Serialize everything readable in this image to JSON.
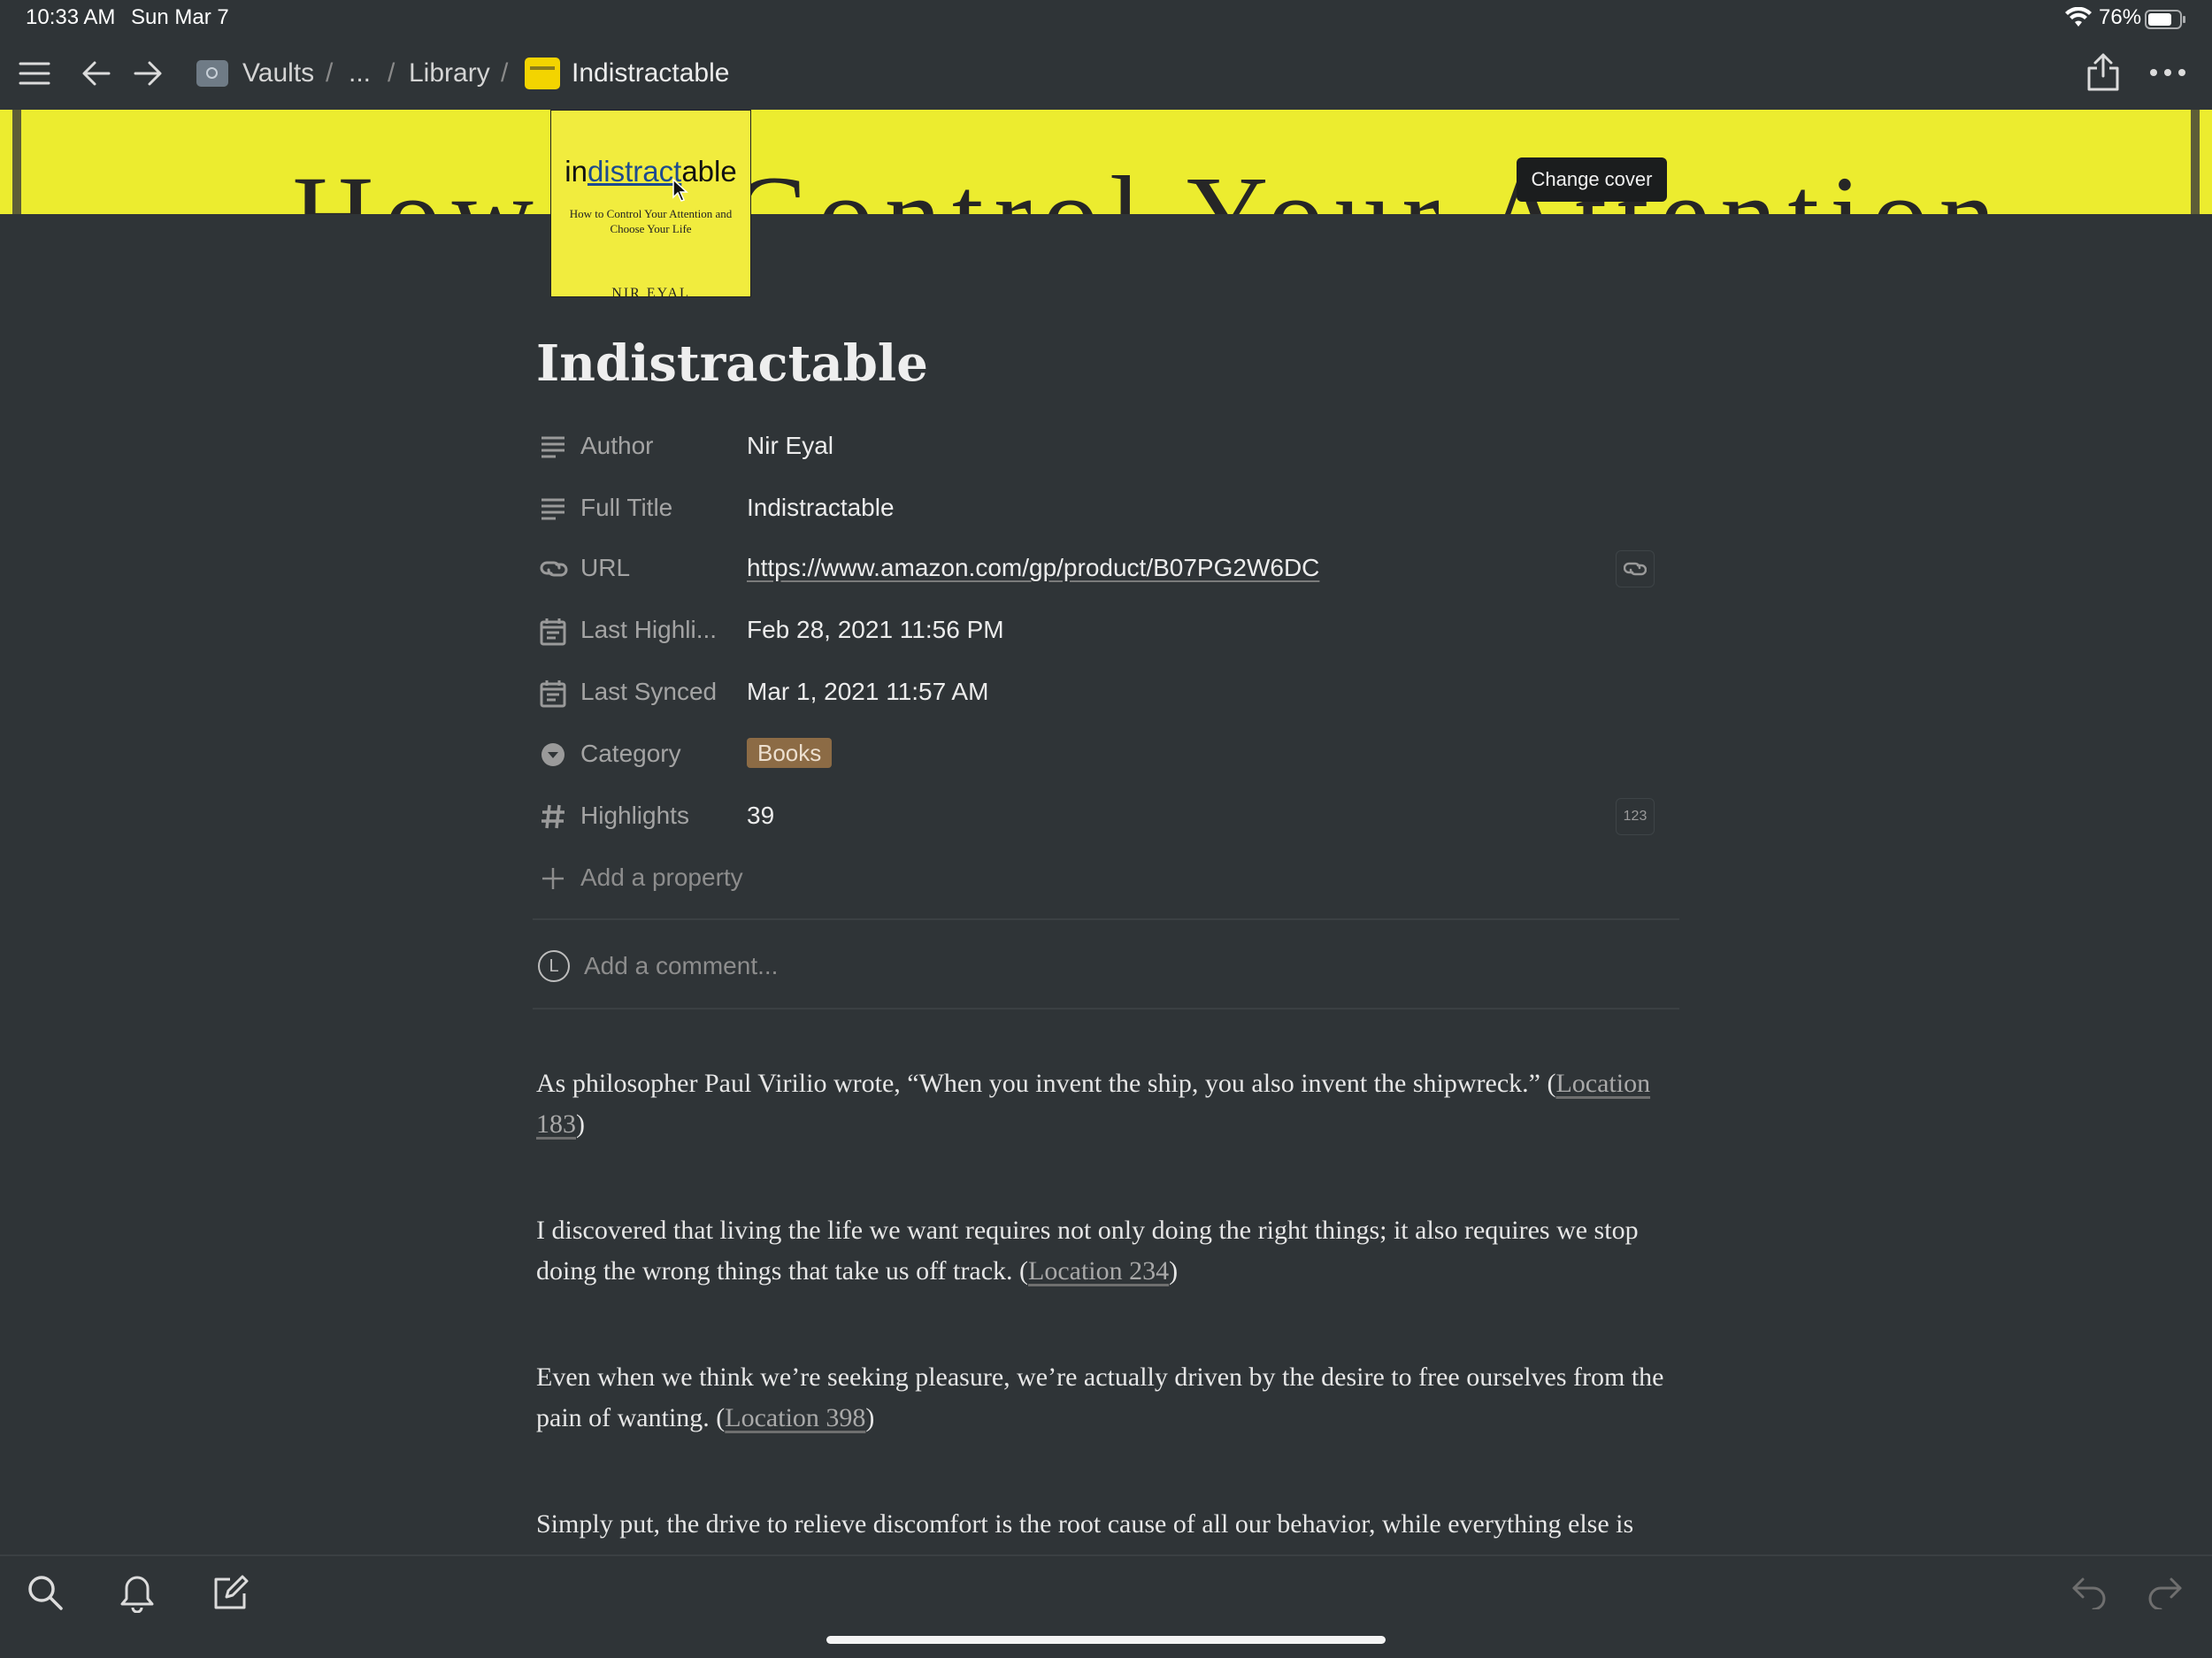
{
  "status_bar": {
    "time": "10:33 AM",
    "date": "Sun Mar 7",
    "battery": "76%"
  },
  "breadcrumb": [
    "Vaults",
    "/",
    "...",
    "/",
    "Library",
    "/",
    "Indistractable"
  ],
  "cover": {
    "letters": "How to Control Your Attention",
    "change_cover_label": "Change cover",
    "book_title_a": "in",
    "book_title_b": "distract",
    "book_title_c": "able",
    "book_subtitle": "How to Control Your Attention and Choose Your Life",
    "book_author": "NIR EYAL"
  },
  "page": {
    "title": "Indistractable"
  },
  "properties": [
    {
      "name": "Author",
      "value": "Nir Eyal",
      "icon": "text-lines-icon"
    },
    {
      "name": "Full Title",
      "value": "Indistractable",
      "icon": "text-lines-icon"
    },
    {
      "name": "URL",
      "value": "https://www.amazon.com/gp/product/B07PG2W6DC",
      "icon": "link-icon"
    },
    {
      "name": "Last Highli...",
      "value": "Feb 28, 2021 11:56 PM",
      "icon": "calendar-icon"
    },
    {
      "name": "Last Synced",
      "value": "Mar 1, 2021 11:57 AM",
      "icon": "calendar-icon"
    },
    {
      "name": "Category",
      "value": "Books",
      "icon": "select-icon"
    },
    {
      "name": "Highlights",
      "value": "39",
      "icon": "hash-icon",
      "side_label": "123"
    }
  ],
  "add_property_label": "Add a property",
  "comment": {
    "avatar_letter": "L",
    "placeholder": "Add a comment..."
  },
  "highlights": [
    {
      "text": "As philosopher Paul Virilio wrote, “When you invent the ship, you also invent the shipwreck.” (",
      "location": "Location 183",
      "tail": ")"
    },
    {
      "text": "I discovered that living the life we want requires not only doing the right things; it also requires we stop doing the wrong things that take us off track. (",
      "location": "Location 234",
      "tail": ")"
    },
    {
      "text": "Even when we think we’re seeking pleasure, we’re actually driven by the desire to free ourselves from the pain of wanting. (",
      "location": "Location 398",
      "tail": ")"
    },
    {
      "text": "Simply put, the drive to relieve discomfort is the root cause of all our behavior, while everything else is",
      "location": "",
      "tail": ""
    }
  ]
}
